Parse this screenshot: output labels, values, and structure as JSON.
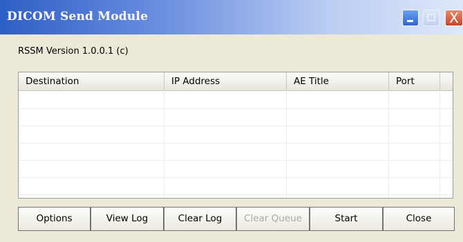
{
  "window": {
    "title": "DICOM Send Module",
    "minimize": "minimize",
    "maximize": "maximize",
    "close": "X"
  },
  "version_label": "RSSM Version 1.0.0.1 (c)",
  "table": {
    "columns": [
      "Destination",
      "IP Address",
      "AE Title",
      "Port"
    ],
    "rows": []
  },
  "buttons": {
    "options": "Options",
    "view_log": "View Log",
    "clear_log": "Clear Log",
    "clear_queue": "Clear Queue",
    "start": "Start",
    "close": "Close"
  },
  "colors": {
    "titlebar_start": "#2e5fc6",
    "face": "#ece9d8",
    "close_button": "#c6452a"
  }
}
